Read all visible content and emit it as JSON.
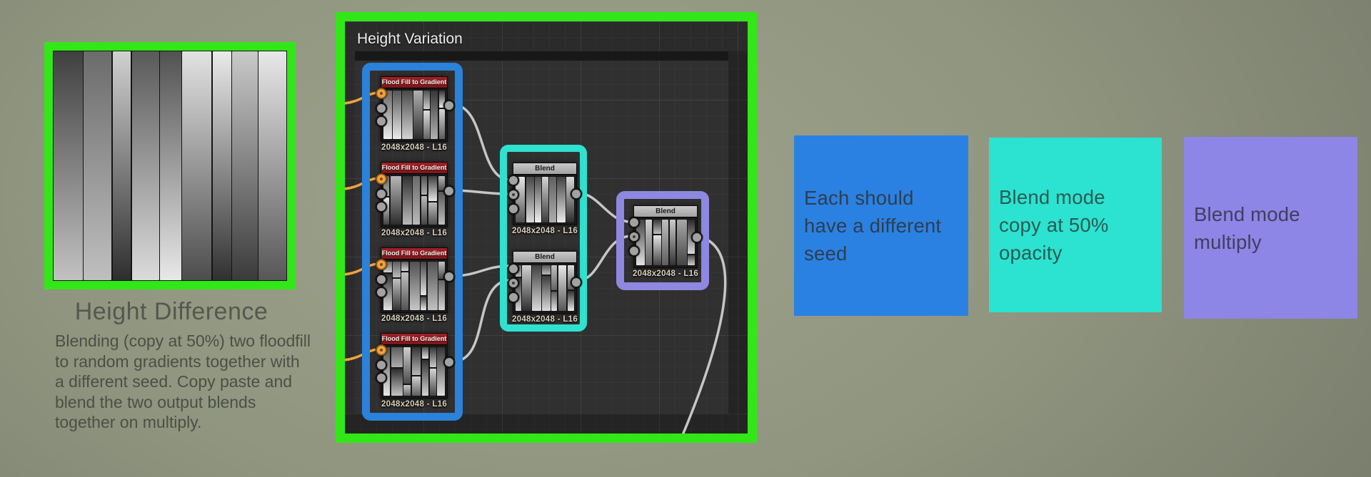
{
  "left_panel": {
    "title": "Height Difference",
    "description_lines": [
      "Blending (copy at 50%) two floodfill",
      "to random gradients together with",
      "a different seed. Copy paste and",
      "blend the two output blends",
      "together on multiply."
    ]
  },
  "graph": {
    "title": "Height Variation",
    "nodes": [
      {
        "title": "Flood Fill to Gradient",
        "size_label": "2048x2048 - L16"
      },
      {
        "title": "Flood Fill to Gradient",
        "size_label": "2048x2048 - L16"
      },
      {
        "title": "Flood Fill to Gradient",
        "size_label": "2048x2048 - L16"
      },
      {
        "title": "Flood Fill to Gradient",
        "size_label": "2048x2048 - L16"
      },
      {
        "title": "Blend",
        "size_label": "2048x2048 - L16"
      },
      {
        "title": "Blend",
        "size_label": "2048x2048 - L16"
      },
      {
        "title": "Blend",
        "size_label": "2048x2048 - L16"
      }
    ],
    "group_colors": {
      "floodfill_group": "#2a82da",
      "copy_blend_group": "#2fe2cf",
      "multiply_blend_group": "#8e88e0"
    }
  },
  "annotations": [
    {
      "lines": [
        "Each should",
        "have a different",
        "seed"
      ],
      "background": "#2a81e2",
      "text_color": "#2e3e50"
    },
    {
      "lines": [
        "Blend mode",
        "copy at 50%",
        "opacity"
      ],
      "background": "#2be3d0",
      "text_color": "#2d5a53"
    },
    {
      "lines": [
        "Blend mode",
        "multiply"
      ],
      "background": "#8d86e6",
      "text_color": "#413e5e"
    }
  ],
  "colors": {
    "panel_border_green": "#32e718",
    "wire_gray": "#c6c6c6",
    "wire_orange": "#f0a23f",
    "node_header_red": "#8e1c22"
  }
}
